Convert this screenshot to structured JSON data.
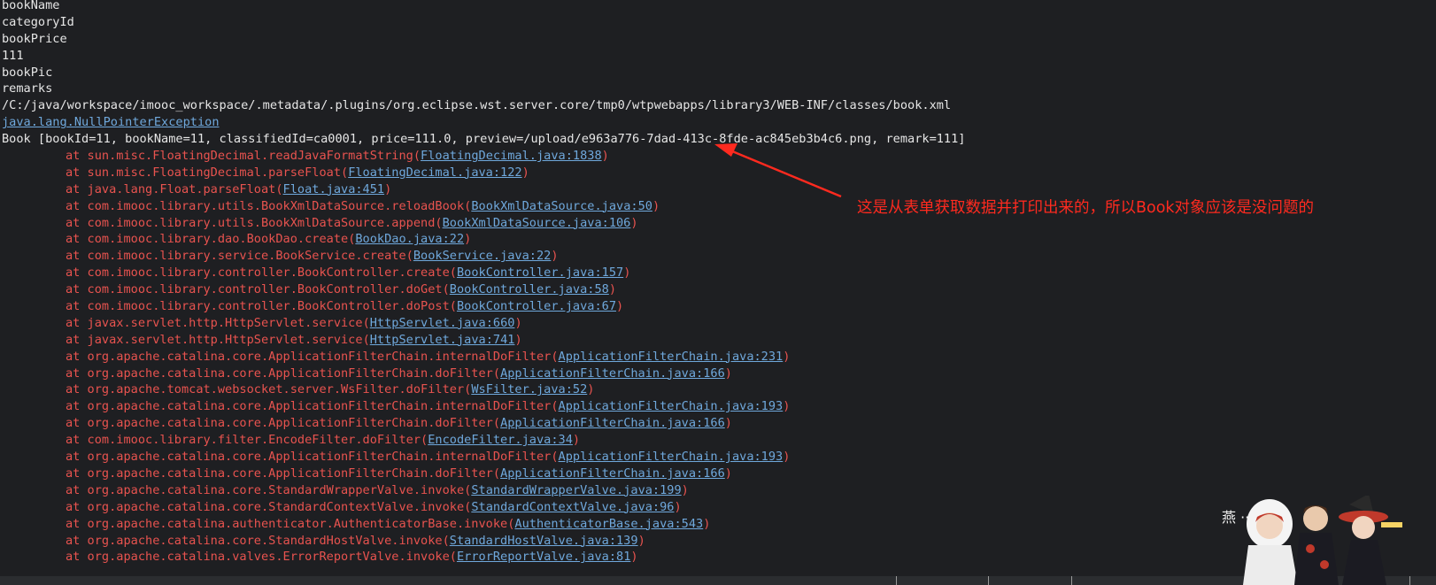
{
  "output_lines": [
    {
      "type": "plain",
      "text": "bookName"
    },
    {
      "type": "plain",
      "text": "categoryId"
    },
    {
      "type": "plain",
      "text": "bookPrice"
    },
    {
      "type": "plain",
      "text": "111"
    },
    {
      "type": "plain",
      "text": "bookPic"
    },
    {
      "type": "plain",
      "text": "remarks"
    },
    {
      "type": "plain",
      "text": "/C:/java/workspace/imooc_workspace/.metadata/.plugins/org.eclipse.wst.server.core/tmp0/wtpwebapps/library3/WEB-INF/classes/book.xml"
    },
    {
      "type": "exception",
      "text": "java.lang.NullPointerException"
    },
    {
      "type": "plain",
      "text": "Book [bookId=11, bookName=11, classifiedId=ca0001, price=111.0, preview=/upload/e963a776-7dad-413c-8fde-ac845eb3b4c6.png, remark=111]"
    },
    {
      "type": "stack",
      "method": "at sun.misc.FloatingDecimal.readJavaFormatString",
      "location": "FloatingDecimal.java:1838"
    },
    {
      "type": "stack",
      "method": "at sun.misc.FloatingDecimal.parseFloat",
      "location": "FloatingDecimal.java:122"
    },
    {
      "type": "stack",
      "method": "at java.lang.Float.parseFloat",
      "location": "Float.java:451"
    },
    {
      "type": "stack",
      "method": "at com.imooc.library.utils.BookXmlDataSource.reloadBook",
      "location": "BookXmlDataSource.java:50"
    },
    {
      "type": "stack",
      "method": "at com.imooc.library.utils.BookXmlDataSource.append",
      "location": "BookXmlDataSource.java:106"
    },
    {
      "type": "stack",
      "method": "at com.imooc.library.dao.BookDao.create",
      "location": "BookDao.java:22"
    },
    {
      "type": "stack",
      "method": "at com.imooc.library.service.BookService.create",
      "location": "BookService.java:22"
    },
    {
      "type": "stack",
      "method": "at com.imooc.library.controller.BookController.create",
      "location": "BookController.java:157"
    },
    {
      "type": "stack",
      "method": "at com.imooc.library.controller.BookController.doGet",
      "location": "BookController.java:58"
    },
    {
      "type": "stack",
      "method": "at com.imooc.library.controller.BookController.doPost",
      "location": "BookController.java:67"
    },
    {
      "type": "stack",
      "method": "at javax.servlet.http.HttpServlet.service",
      "location": "HttpServlet.java:660"
    },
    {
      "type": "stack",
      "method": "at javax.servlet.http.HttpServlet.service",
      "location": "HttpServlet.java:741"
    },
    {
      "type": "stack",
      "method": "at org.apache.catalina.core.ApplicationFilterChain.internalDoFilter",
      "location": "ApplicationFilterChain.java:231"
    },
    {
      "type": "stack",
      "method": "at org.apache.catalina.core.ApplicationFilterChain.doFilter",
      "location": "ApplicationFilterChain.java:166"
    },
    {
      "type": "stack",
      "method": "at org.apache.tomcat.websocket.server.WsFilter.doFilter",
      "location": "WsFilter.java:52"
    },
    {
      "type": "stack",
      "method": "at org.apache.catalina.core.ApplicationFilterChain.internalDoFilter",
      "location": "ApplicationFilterChain.java:193"
    },
    {
      "type": "stack",
      "method": "at org.apache.catalina.core.ApplicationFilterChain.doFilter",
      "location": "ApplicationFilterChain.java:166"
    },
    {
      "type": "stack",
      "method": "at com.imooc.library.filter.EncodeFilter.doFilter",
      "location": "EncodeFilter.java:34"
    },
    {
      "type": "stack",
      "method": "at org.apache.catalina.core.ApplicationFilterChain.internalDoFilter",
      "location": "ApplicationFilterChain.java:193"
    },
    {
      "type": "stack",
      "method": "at org.apache.catalina.core.ApplicationFilterChain.doFilter",
      "location": "ApplicationFilterChain.java:166"
    },
    {
      "type": "stack",
      "method": "at org.apache.catalina.core.StandardWrapperValve.invoke",
      "location": "StandardWrapperValve.java:199"
    },
    {
      "type": "stack",
      "method": "at org.apache.catalina.core.StandardContextValve.invoke",
      "location": "StandardContextValve.java:96"
    },
    {
      "type": "stack",
      "method": "at org.apache.catalina.authenticator.AuthenticatorBase.invoke",
      "location": "AuthenticatorBase.java:543"
    },
    {
      "type": "stack",
      "method": "at org.apache.catalina.core.StandardHostValve.invoke",
      "location": "StandardHostValve.java:139"
    },
    {
      "type": "stack",
      "method": "at org.apache.catalina.valves.ErrorReportValve.invoke",
      "location": "ErrorReportValve.java:81"
    }
  ],
  "annotation": {
    "text": "这是从表单获取数据并打印出来的，所以Book对象应该是没问题的",
    "color": "#ff2a1f"
  },
  "watermark": {
    "text": "燕 ·· 简",
    "icon": "anime-mascot-icon"
  },
  "colors": {
    "background": "#1e1f22",
    "plain_text": "#e6e6e6",
    "stack_text": "#e8534f",
    "link": "#6fa8dc"
  }
}
